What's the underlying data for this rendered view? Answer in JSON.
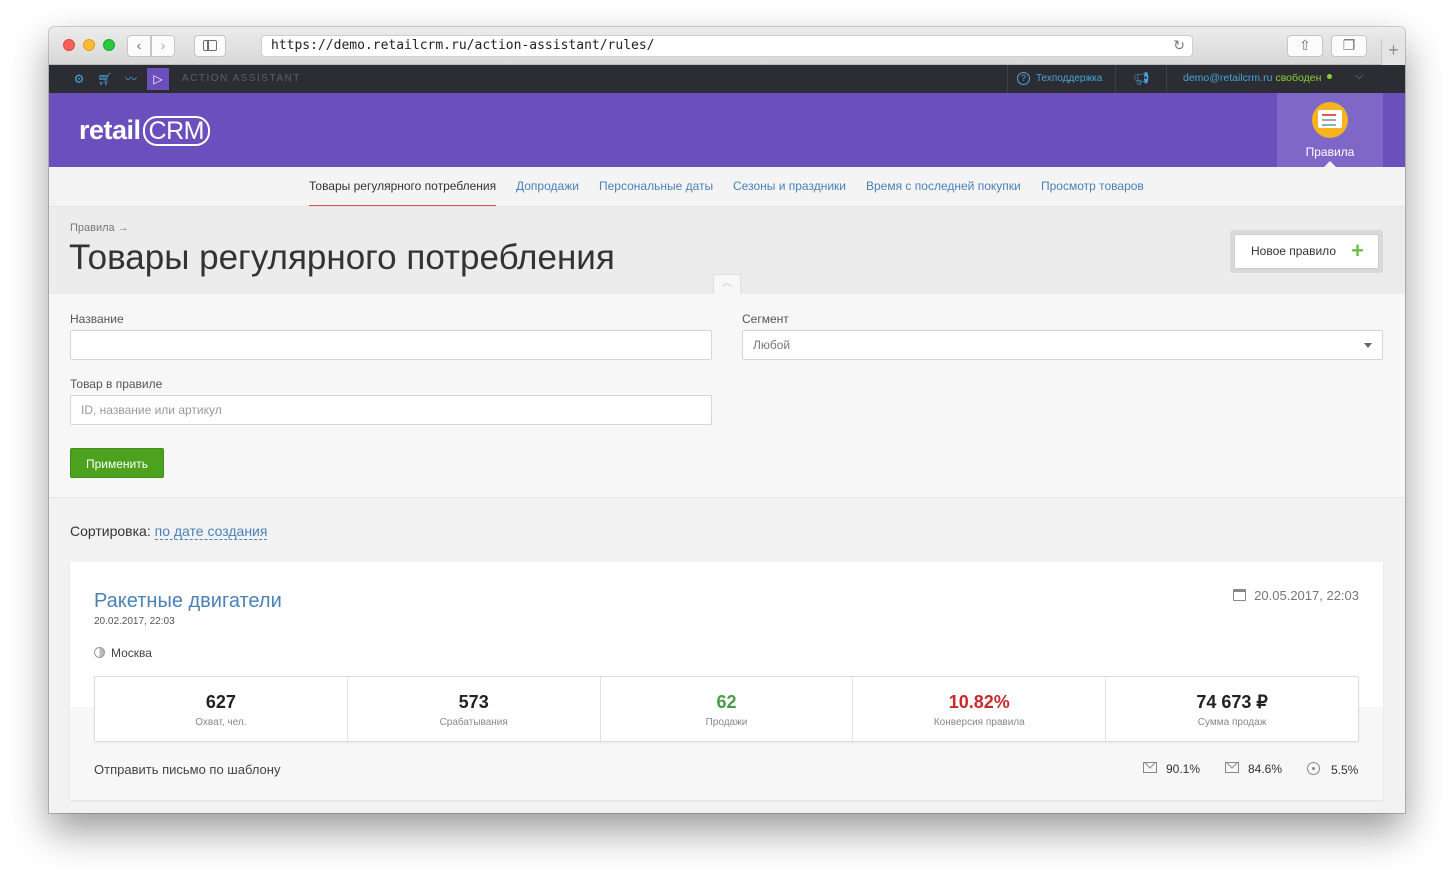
{
  "browser": {
    "url": "https://demo.retailcrm.ru/action-assistant/rules/"
  },
  "topbar": {
    "app_label": "ACTION ASSISTANT",
    "support": "Техподдержка",
    "user_email": "demo@retailcrm.ru",
    "user_status": "свободен",
    "status_color": "#8bd130"
  },
  "header": {
    "logo_prefix": "retail",
    "logo_crm": "CRM",
    "tile_label": "Правила",
    "brand_color": "#6a4fbd"
  },
  "subnav": {
    "tabs": [
      {
        "label": "Товары регулярного потребления",
        "active": true
      },
      {
        "label": "Допродажи"
      },
      {
        "label": "Персональные даты"
      },
      {
        "label": "Сезоны и праздники"
      },
      {
        "label": "Время с последней покупки"
      },
      {
        "label": "Просмотр товаров"
      }
    ]
  },
  "page": {
    "breadcrumb": "Правила →",
    "title": "Товары регулярного потребления",
    "new_rule_button": "Новое правило"
  },
  "filters": {
    "name_label": "Название",
    "name_value": "",
    "segment_label": "Сегмент",
    "segment_value": "Любой",
    "product_label": "Товар в правиле",
    "product_placeholder": "ID, название или артикул",
    "apply_button": "Применить"
  },
  "sorting": {
    "label": "Сортировка:",
    "value": "по дате создания"
  },
  "rule": {
    "name": "Ракетные двигатели",
    "created": "20.02.2017, 22:03",
    "segment": "Москва",
    "updated": "20.05.2017, 22:03",
    "stats": [
      {
        "value": "627",
        "label": "Охват, чел."
      },
      {
        "value": "573",
        "label": "Срабатывания"
      },
      {
        "value": "62",
        "label": "Продажи"
      },
      {
        "value": "10.82%",
        "label": "Конверсия правила"
      },
      {
        "value": "74 673 ₽",
        "label": "Сумма продаж"
      }
    ],
    "action": "Отправить письмо по шаблону",
    "metrics": {
      "delivered": "90.1%",
      "opened": "84.6%",
      "clicked": "5.5%"
    }
  }
}
